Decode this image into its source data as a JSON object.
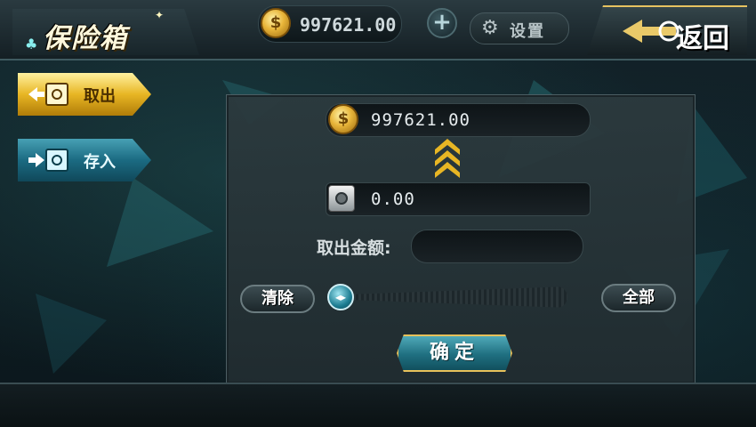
{
  "header": {
    "title": "保险箱",
    "coin_balance": "997621.00",
    "plus_label": "+",
    "settings_label": "设置",
    "back_label": "返回"
  },
  "sidebar": {
    "tabs": [
      {
        "label": "取出",
        "icon": "safe-withdraw-icon",
        "active": true
      },
      {
        "label": "存入",
        "icon": "safe-deposit-icon",
        "active": false
      }
    ]
  },
  "panel": {
    "carried_coins": "997621.00",
    "bank_balance": "0.00",
    "amount_label": "取出金额:",
    "amount_value": "",
    "amount_placeholder": "",
    "clear_label": "清除",
    "all_label": "全部",
    "confirm_label": "确定",
    "slider_fraction": 0
  },
  "colors": {
    "gold": "#e8b624",
    "teal": "#1b6b82",
    "panel": "#2c3a3e"
  }
}
